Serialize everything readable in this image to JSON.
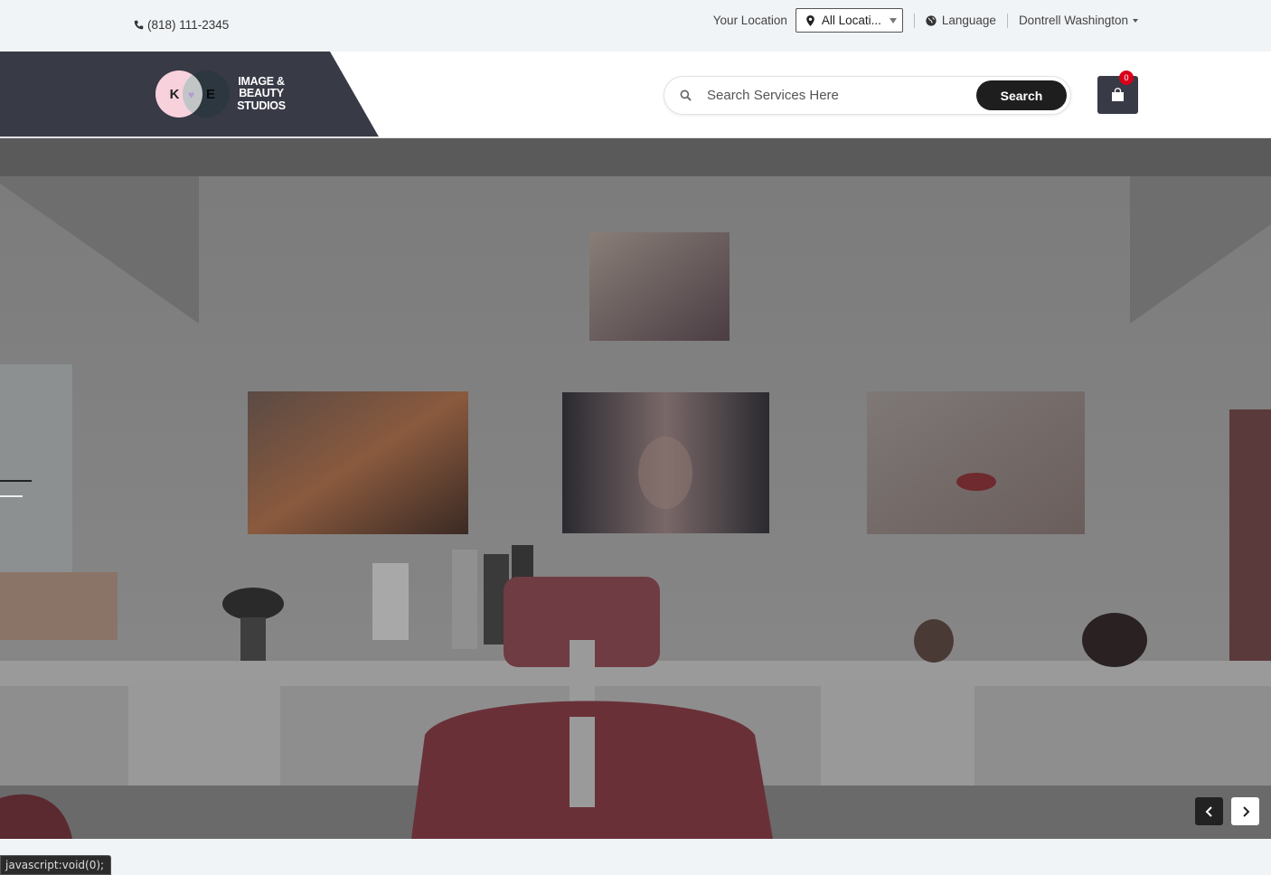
{
  "topbar": {
    "phone": "(818) 111-2345",
    "location_label": "Your Location",
    "location_value": "All Locati...",
    "language": "Language",
    "user_name": "Dontrell Washington"
  },
  "header": {
    "logo_left_letter": "K",
    "logo_right_letter": "E",
    "logo_line1": "IMAGE &",
    "logo_line2": "BEAUTY",
    "logo_line3": "STUDIOS",
    "search_placeholder": "Search Services Here",
    "search_button": "Search",
    "cart_count": "0"
  },
  "status_bar": "javascript:void(0);",
  "colors": {
    "header_dark": "#383a46",
    "badge_red": "#d8001a",
    "search_button": "#1e1e1e"
  },
  "icons": [
    "phone-icon",
    "map-pin-icon",
    "globe-icon",
    "search-icon",
    "shopping-bag-icon",
    "chevron-left-icon",
    "chevron-right-icon"
  ]
}
